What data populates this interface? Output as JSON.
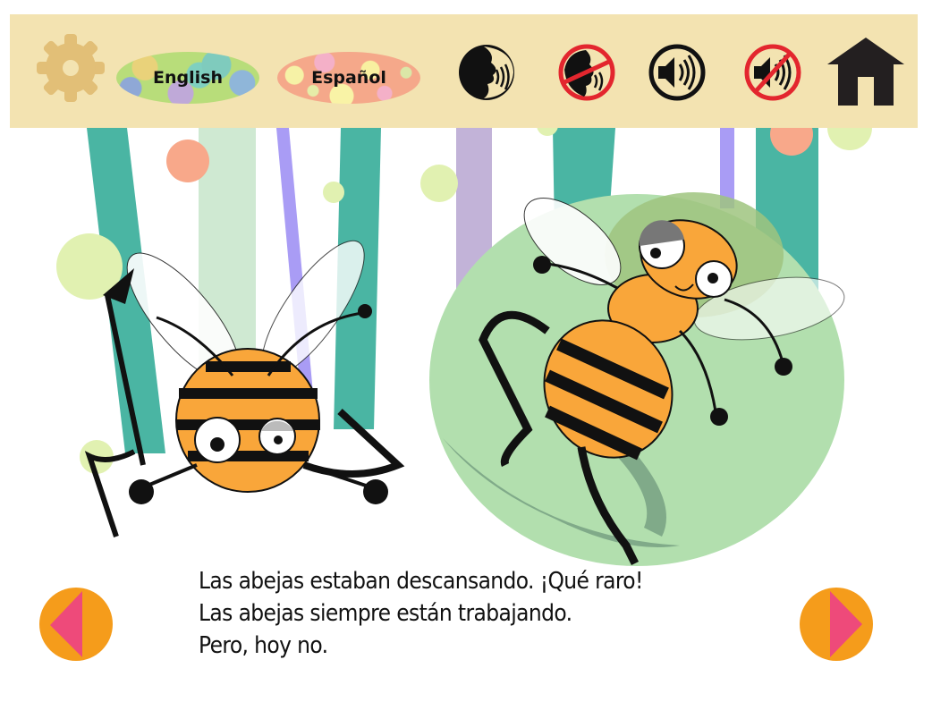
{
  "toolbar": {
    "settings": {
      "icon": "gear-icon",
      "color": "#e2bf77"
    },
    "languages": [
      {
        "label": "English",
        "selected": false
      },
      {
        "label": "Español",
        "selected": true
      }
    ],
    "audio_buttons": [
      {
        "icon": "narration-on-icon"
      },
      {
        "icon": "narration-off-icon"
      },
      {
        "icon": "sound-on-icon"
      },
      {
        "icon": "sound-off-icon"
      }
    ],
    "home": {
      "icon": "home-icon"
    },
    "background_color": "#f3e3b1"
  },
  "story": {
    "lines": [
      "Las abejas estaban descansando. ¡Qué raro!",
      "Las abejas siempre están trabajando.",
      "Pero, hoy no."
    ]
  },
  "navigation": {
    "previous": {
      "icon": "previous-page-icon"
    },
    "next": {
      "icon": "next-page-icon"
    },
    "circle_color": "#f59c1b",
    "arrow_color": "#ee4a7a"
  },
  "illustration": {
    "description": "Two cartoon bees resting; one upside-down on the left, one lying on a green leaf on the right",
    "colors": {
      "teal": "#4ab5a3",
      "mint": "#cfe9d2",
      "violet": "#a99cf5",
      "lavender": "#c2b3d8",
      "leaf": "#b2dfae",
      "leaf_shadow": "#739c7f",
      "bee_orange": "#f9a63a",
      "dot_lime": "#e1f1b1",
      "dot_salmon": "#f8a88a"
    }
  }
}
